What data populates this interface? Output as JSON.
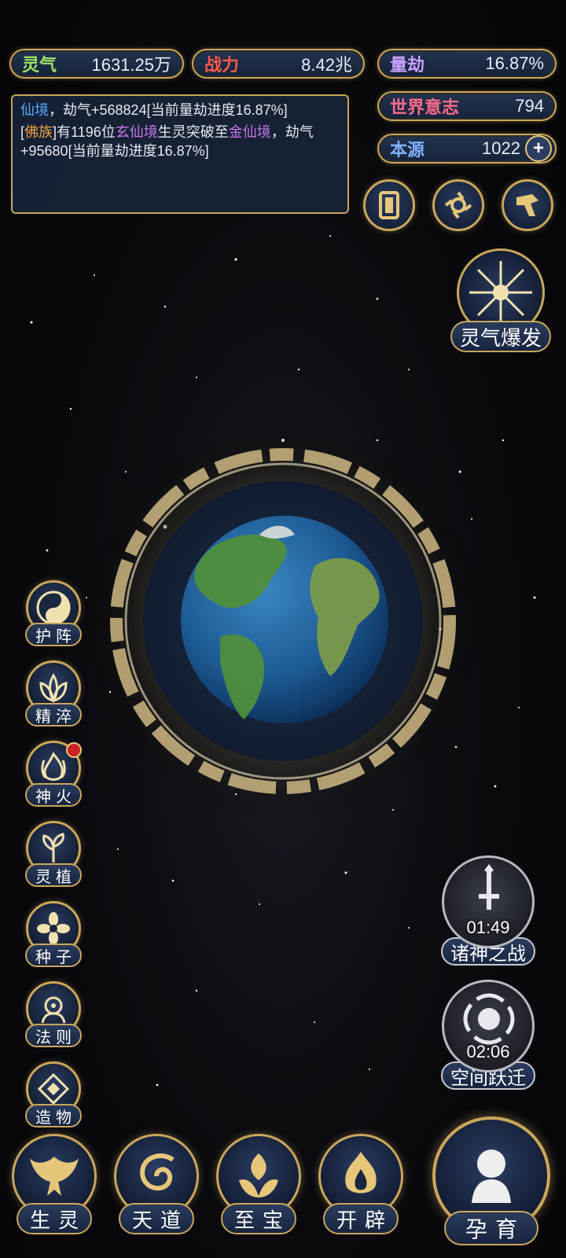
{
  "resources": {
    "lingqi": {
      "label": "灵气",
      "value": "1631.25万"
    },
    "zhanli": {
      "label": "战力",
      "value": "8.42兆"
    },
    "liangjie": {
      "label": "量劫",
      "value": "16.87%"
    },
    "shijie": {
      "label": "世界意志",
      "value": "794"
    },
    "benyuan": {
      "label": "本源",
      "value": "1022"
    }
  },
  "log": {
    "line1": {
      "place": "仙境",
      "rest": "，劫气+568824[当前量劫进度16.87%]"
    },
    "line2": {
      "open": "[",
      "race": "佛族",
      "mid1": "]有1196位",
      "realm1": "玄仙境",
      "mid2": "生灵突破至",
      "realm2": "金仙境",
      "rest": "，劫气+95680[当前量劫进度16.87%]"
    }
  },
  "burst": {
    "label": "灵气爆发"
  },
  "skills": [
    {
      "label": "护阵",
      "icon": "yin-yang-icon"
    },
    {
      "label": "精淬",
      "icon": "lotus-icon"
    },
    {
      "label": "神火",
      "icon": "flame-icon"
    },
    {
      "label": "灵植",
      "icon": "plant-icon"
    },
    {
      "label": "种子",
      "icon": "flower-icon"
    },
    {
      "label": "法则",
      "icon": "law-icon"
    },
    {
      "label": "造物",
      "icon": "diamond-icon"
    }
  ],
  "events": {
    "war": {
      "label": "诸神之战",
      "timer": "01:49"
    },
    "jump": {
      "label": "空间跃迁",
      "timer": "02:06"
    }
  },
  "nav": [
    {
      "label": "生灵",
      "icon": "phoenix-icon"
    },
    {
      "label": "天道",
      "icon": "swirl-icon"
    },
    {
      "label": "至宝",
      "icon": "treasure-icon"
    },
    {
      "label": "开辟",
      "icon": "flame-icon"
    },
    {
      "label": "孕育",
      "icon": "spirit-icon"
    }
  ],
  "colors": {
    "gold": "#c9a65a",
    "accent_blue": "#5aa6ff",
    "accent_orange": "#f0a24a",
    "accent_purple": "#c777e8"
  }
}
